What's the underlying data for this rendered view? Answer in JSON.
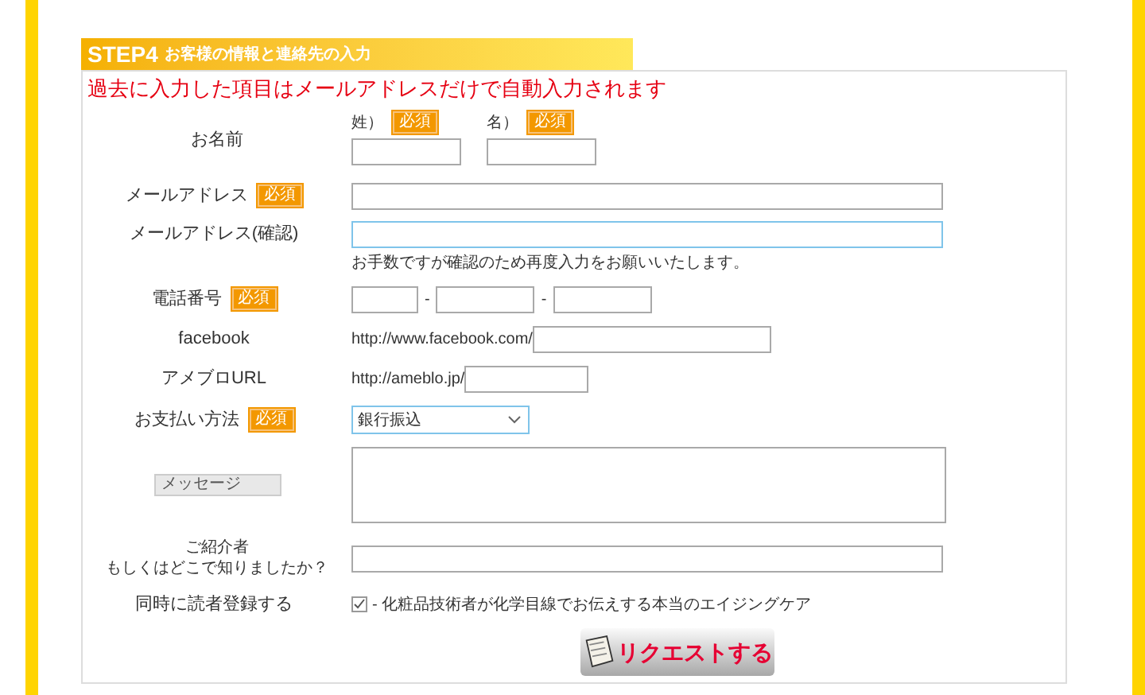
{
  "header": {
    "step": "STEP4",
    "title": "お客様の情報と連絡先の入力"
  },
  "notice": "過去に入力した項目はメールアドレスだけで自動入力されます",
  "rows": [
    {
      "kind": "name",
      "label": "お名前",
      "parts": [
        {
          "label": "姓）",
          "badge": "必須"
        },
        {
          "label": "名）",
          "badge": "必須"
        }
      ]
    },
    {
      "kind": "text",
      "label": "メールアドレス",
      "badge": "必須",
      "focused": false
    },
    {
      "kind": "text",
      "label": "メールアドレス(確認)",
      "focused": true,
      "note": "お手数ですが確認のため再度入力をお願いいたします。"
    },
    {
      "kind": "phone",
      "label": "電話番号",
      "badge": "必須",
      "separators": [
        "-",
        "-"
      ]
    },
    {
      "kind": "url",
      "label": "facebook",
      "prefix": "http://www.facebook.com/"
    },
    {
      "kind": "url",
      "label": "アメブロURL",
      "prefix": "http://ameblo.jp/"
    },
    {
      "kind": "select",
      "label": "お支払い方法",
      "badge": "必須",
      "value": "銀行振込"
    },
    {
      "kind": "textarea",
      "label": "メッセージ"
    },
    {
      "kind": "text2",
      "label": "ご紹介者",
      "label2": "もしくはどこで知りましたか？"
    },
    {
      "kind": "check",
      "label": "同時に読者登録する",
      "checked": true,
      "text": "- 化粧品技術者が化学目線でお伝えする本当のエイジングケア"
    }
  ],
  "submit": "リクエストする"
}
